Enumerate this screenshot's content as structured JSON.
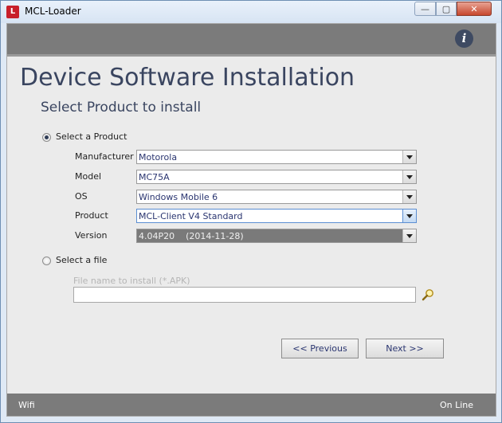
{
  "window": {
    "title": "MCL-Loader",
    "app_icon_text": "L",
    "min_glyph": "—",
    "max_glyph": "▢",
    "close_glyph": "✕"
  },
  "topbar": {
    "info_glyph": "i"
  },
  "page": {
    "heading": "Device Software Installation",
    "subheading": "Select Product to install"
  },
  "options": {
    "product_radio": {
      "label": "Select a Product",
      "checked": true
    },
    "file_radio": {
      "label": "Select a file",
      "checked": false
    }
  },
  "fields": {
    "manufacturer": {
      "label": "Manufacturer",
      "value": "Motorola"
    },
    "model": {
      "label": "Model",
      "value": "MC75A"
    },
    "os": {
      "label": "OS",
      "value": "Windows Mobile 6"
    },
    "product": {
      "label": "Product",
      "value": "MCL-Client V4 Standard"
    },
    "version": {
      "label": "Version",
      "value": "4.04P20    (2014-11-28)"
    }
  },
  "file": {
    "hint": "File name to install (*.APK)",
    "value": ""
  },
  "buttons": {
    "previous": "<<  Previous",
    "next": "Next  >>"
  },
  "status": {
    "left": "Wifi",
    "right": "On Line"
  },
  "colors": {
    "accent": "#3a4560",
    "bar": "#7b7b7b",
    "brand": "#c8202a"
  }
}
